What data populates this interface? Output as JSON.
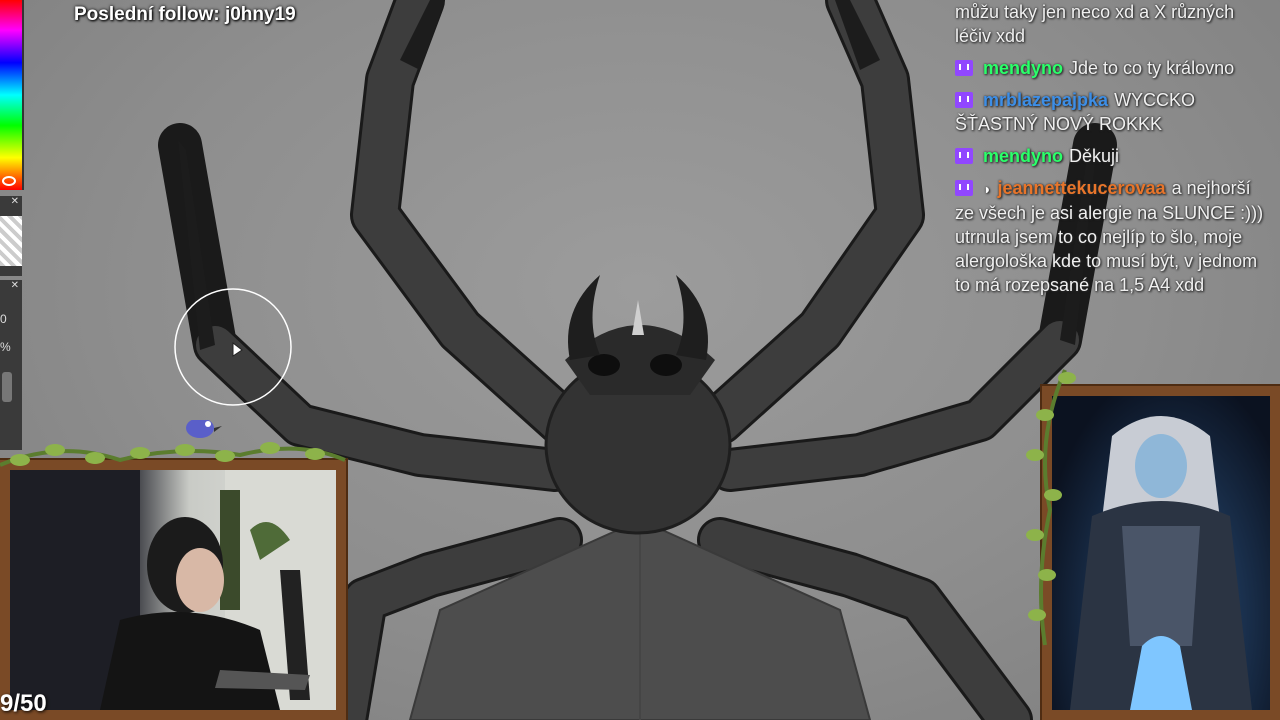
{
  "overlay": {
    "follow_text": "Poslední follow: j0hny19",
    "counter": "9/50"
  },
  "chat": [
    {
      "user": "",
      "user_color": "#ffffff",
      "text": "můžu taky jen neco xd a X různých léčiv xdd",
      "badge": false
    },
    {
      "user": "mendyno",
      "user_color": "#2bff6a",
      "text": "Jde to co ty královno",
      "badge": true
    },
    {
      "user": "mrblazepajpka",
      "user_color": "#3d8ee6",
      "text": "WYCCKO ŠŤASTNÝ NOVÝ ROKKK",
      "badge": true
    },
    {
      "user": "mendyno",
      "user_color": "#2bff6a",
      "text": "Děkuji",
      "badge": true
    },
    {
      "user": "jeannettekucerovaa",
      "user_color": "#e8752a",
      "text": "a nejhorší ze všech je asi alergie na SLUNCE :))) utrnula jsem to co nejlíp to šlo, moje alergološka kde to musí být, v jednom to má rozepsané na 1,5 A4 xdd",
      "badge": true,
      "extra_icon": "half-circle-icon"
    }
  ],
  "tool_panel": {
    "zoom_value": "0",
    "percent_label": "%"
  },
  "colors": {
    "frame": "#7a4a26",
    "twitch_badge": "#9147ff",
    "canvas": "#8e8e8e",
    "spider": "#2e2e2e"
  }
}
